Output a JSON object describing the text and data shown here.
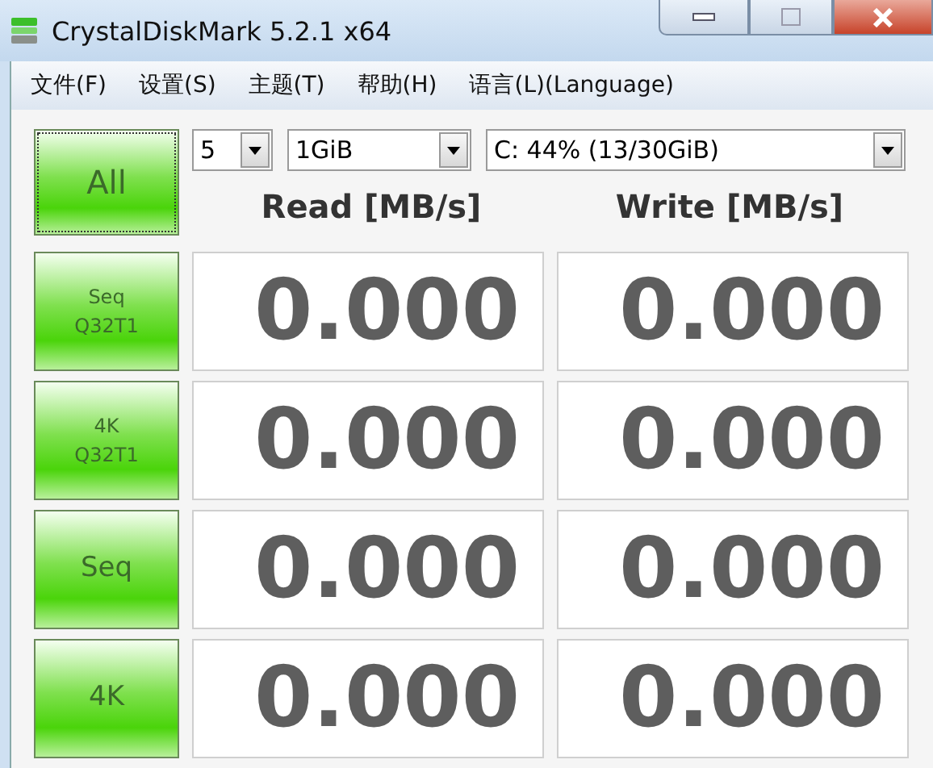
{
  "window": {
    "title": "CrystalDiskMark 5.2.1 x64"
  },
  "menu": [
    "文件(F)",
    "设置(S)",
    "主题(T)",
    "帮助(H)",
    "语言(L)(Language)"
  ],
  "all_button": "All",
  "selectors": [
    {
      "value": "5"
    },
    {
      "value": "1GiB"
    },
    {
      "value": "C: 44% (13/30GiB)"
    }
  ],
  "columns": [
    "Read [MB/s]",
    "Write [MB/s]"
  ],
  "rows": [
    {
      "label": [
        "Seq",
        "Q32T1"
      ],
      "read": "0.000",
      "write": "0.000"
    },
    {
      "label": [
        "4K",
        "Q32T1"
      ],
      "read": "0.000",
      "write": "0.000"
    },
    {
      "label": [
        "Seq"
      ],
      "read": "0.000",
      "write": "0.000"
    },
    {
      "label": [
        "4K"
      ],
      "read": "0.000",
      "write": "0.000"
    }
  ]
}
